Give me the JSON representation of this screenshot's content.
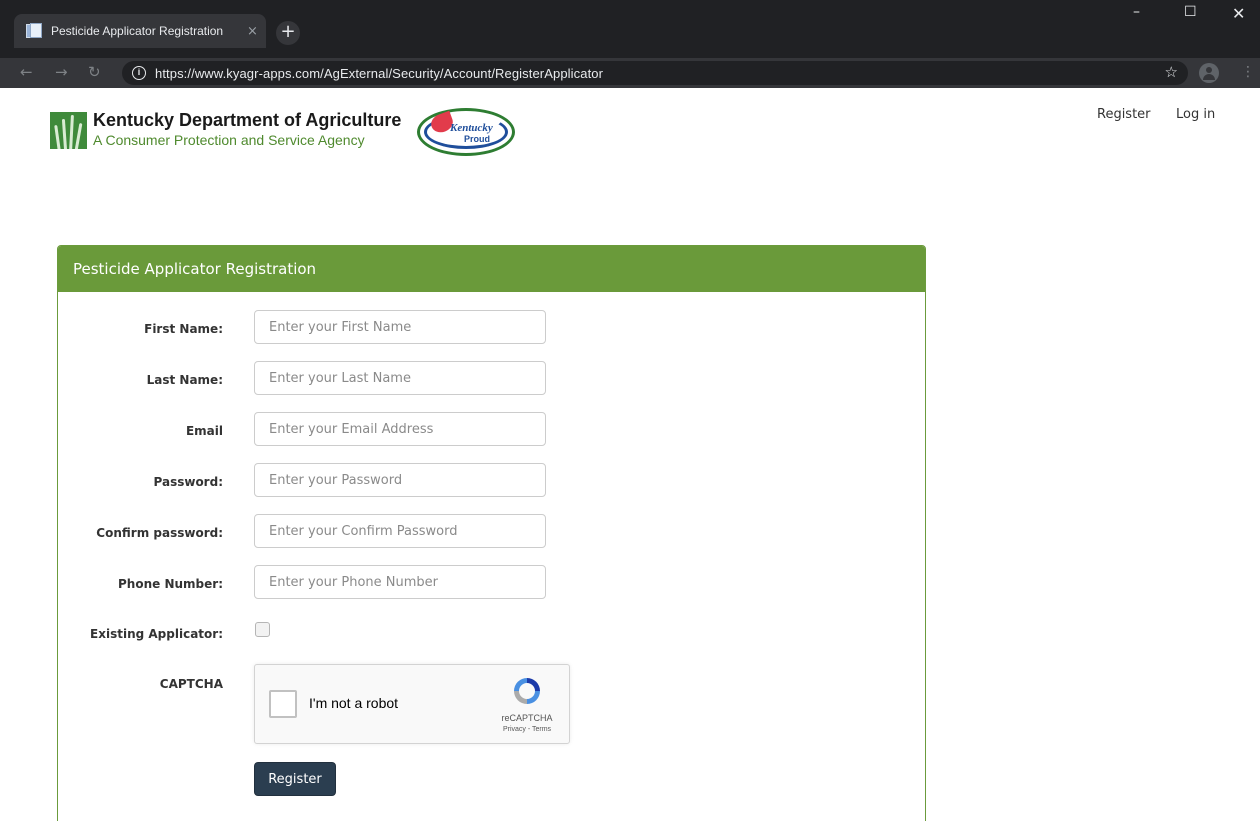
{
  "browser": {
    "tab_title": "Pesticide Applicator Registration",
    "tab_close": "×",
    "new_tab": "+",
    "url": "https://www.kyagr-apps.com/AgExternal/Security/Account/RegisterApplicator",
    "info_glyph": "i",
    "icons": [
      "back-arrow",
      "forward-arrow",
      "reload",
      "info",
      "star",
      "account",
      "menu",
      "minimize",
      "maximize",
      "close"
    ]
  },
  "header": {
    "org_title": "Kentucky Department of Agriculture",
    "org_subtitle": "A Consumer Protection and Service Agency",
    "proud_logo_word": "Kentucky",
    "proud_logo_proud": "Proud",
    "nav": {
      "register": "Register",
      "login": "Log in"
    }
  },
  "form": {
    "panel_title": "Pesticide Applicator Registration",
    "fields": [
      {
        "label": "First Name:",
        "placeholder": "Enter your First Name"
      },
      {
        "label": "Last Name:",
        "placeholder": "Enter your Last Name"
      },
      {
        "label": "Email",
        "placeholder": "Enter your Email Address"
      },
      {
        "label": "Password:",
        "placeholder": "Enter your Password"
      },
      {
        "label": "Confirm password:",
        "placeholder": "Enter your Confirm Password"
      },
      {
        "label": "Phone Number:",
        "placeholder": "Enter your Phone Number"
      }
    ],
    "existing_applicator": {
      "label": "Existing Applicator:",
      "checked": false
    },
    "captcha": {
      "label": "CAPTCHA",
      "checkbox_text": "I'm not a robot",
      "brand": "reCAPTCHA",
      "links": "Privacy - Terms"
    },
    "submit_label": "Register"
  },
  "colors": {
    "panel_header": "#6a9a3a",
    "button": "#2b3e50",
    "chrome_dark": "#202124"
  }
}
